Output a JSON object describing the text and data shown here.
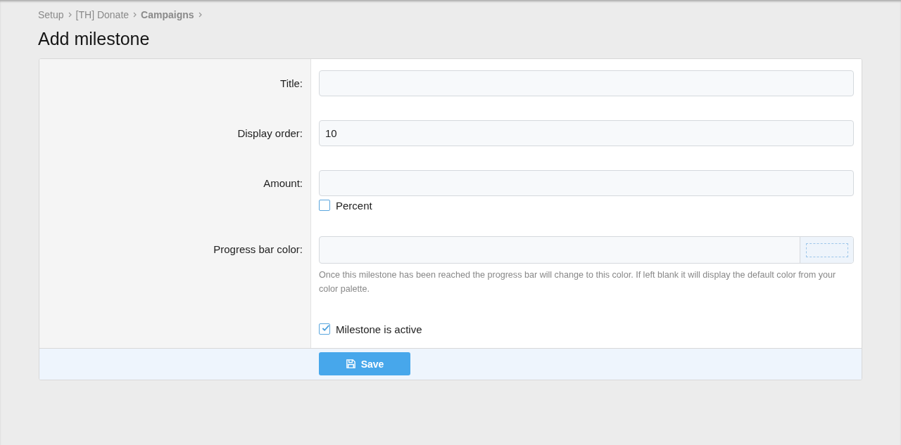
{
  "breadcrumb": [
    {
      "label": "Setup",
      "current": false
    },
    {
      "label": "[TH] Donate",
      "current": false
    },
    {
      "label": "Campaigns",
      "current": true
    }
  ],
  "title": "Add milestone",
  "rows": [
    {
      "kind": "text",
      "label": "Title:"
    },
    {
      "kind": "text",
      "label": "Display order:",
      "value": "10"
    },
    {
      "kind": "text",
      "label": "Amount:",
      "option": {
        "label": "Percent",
        "checked": false
      }
    },
    {
      "kind": "color",
      "label": "Progress bar color:",
      "help": "Once this milestone has been reached the progress bar will change to this color. If left blank it will display the default color from your color palette."
    },
    {
      "kind": "checkbox",
      "option": {
        "label": "Milestone is active",
        "checked": true
      }
    }
  ],
  "save_button": "Save"
}
